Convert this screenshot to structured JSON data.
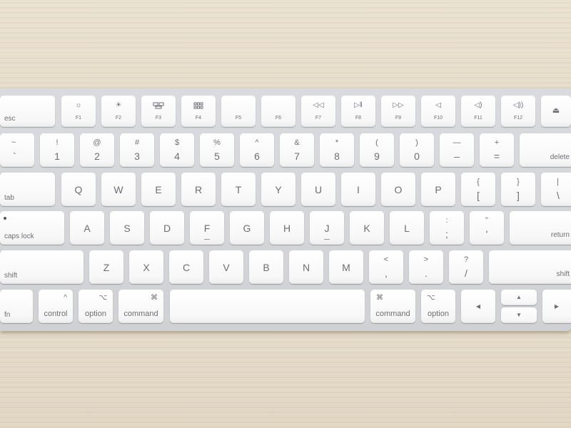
{
  "keyboard": {
    "function_row": {
      "esc": "esc",
      "keys": [
        {
          "label": "F1",
          "icon": "brightness-down-icon"
        },
        {
          "label": "F2",
          "icon": "brightness-up-icon"
        },
        {
          "label": "F3",
          "icon": "mission-control-icon"
        },
        {
          "label": "F4",
          "icon": "launchpad-icon"
        },
        {
          "label": "F5",
          "icon": ""
        },
        {
          "label": "F6",
          "icon": ""
        },
        {
          "label": "F7",
          "icon": "rewind-icon"
        },
        {
          "label": "F8",
          "icon": "play-pause-icon"
        },
        {
          "label": "F9",
          "icon": "fast-forward-icon"
        },
        {
          "label": "F10",
          "icon": "mute-icon"
        },
        {
          "label": "F11",
          "icon": "volume-down-icon"
        },
        {
          "label": "F12",
          "icon": "volume-up-icon"
        }
      ],
      "eject_icon": "eject-icon"
    },
    "number_row": {
      "keys": [
        {
          "upper": "~",
          "lower": "`"
        },
        {
          "upper": "!",
          "lower": "1"
        },
        {
          "upper": "@",
          "lower": "2"
        },
        {
          "upper": "#",
          "lower": "3"
        },
        {
          "upper": "$",
          "lower": "4"
        },
        {
          "upper": "%",
          "lower": "5"
        },
        {
          "upper": "^",
          "lower": "6"
        },
        {
          "upper": "&",
          "lower": "7"
        },
        {
          "upper": "*",
          "lower": "8"
        },
        {
          "upper": "(",
          "lower": "9"
        },
        {
          "upper": ")",
          "lower": "0"
        },
        {
          "upper": "—",
          "lower": "–"
        },
        {
          "upper": "+",
          "lower": "="
        }
      ],
      "delete": "delete"
    },
    "top_row": {
      "tab": "tab",
      "letters": [
        "Q",
        "W",
        "E",
        "R",
        "T",
        "Y",
        "U",
        "I",
        "O",
        "P"
      ],
      "brackets": [
        {
          "upper": "{",
          "lower": "["
        },
        {
          "upper": "}",
          "lower": "]"
        },
        {
          "upper": "|",
          "lower": "\\"
        }
      ]
    },
    "home_row": {
      "caps": "caps lock",
      "letters": [
        "A",
        "S",
        "D",
        "F",
        "G",
        "H",
        "J",
        "K",
        "L"
      ],
      "punct": [
        {
          "upper": ":",
          "lower": ";"
        },
        {
          "upper": "\"",
          "lower": "'"
        }
      ],
      "return": "return"
    },
    "bottom_row": {
      "shift_left": "shift",
      "letters": [
        "Z",
        "X",
        "C",
        "V",
        "B",
        "N",
        "M"
      ],
      "punct": [
        {
          "upper": "<",
          "lower": ","
        },
        {
          "upper": ">",
          "lower": "."
        },
        {
          "upper": "?",
          "lower": "/"
        }
      ],
      "shift_right": "shift"
    },
    "space_row": {
      "fn": "fn",
      "control": {
        "label": "control",
        "symbol": "^"
      },
      "option_left": {
        "label": "option",
        "symbol": "⌥"
      },
      "command_left": {
        "label": "command",
        "symbol": "⌘"
      },
      "command_right": {
        "label": "command",
        "symbol": "⌘"
      },
      "option_right": {
        "label": "option",
        "symbol": "⌥"
      },
      "arrows": {
        "left": "◀",
        "up": "▲",
        "down": "▼",
        "right": "▶"
      }
    }
  }
}
